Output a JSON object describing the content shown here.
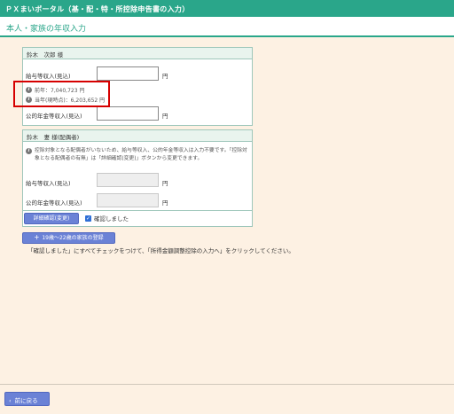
{
  "header": {
    "title": "ＰＸまいポータル（基・配・特・所控除申告書の入力）"
  },
  "page": {
    "title": "本人・家族の年収入力"
  },
  "person1": {
    "name": "鈴木　次郎 様",
    "salary_label": "給与等収入(見込)",
    "salary_value": "",
    "yen": "円",
    "prev_year": "前年：7,040,723 円",
    "current": "当年(現時点)：6,203,652 円",
    "pension_label": "公的年金等収入(見込)",
    "pension_value": "",
    "yen2": "円"
  },
  "person2": {
    "name": "鈴木　妻 様(配偶者)",
    "note": "控除対象となる配偶者がいないため、給与等収入、公的年金等収入は入力不要です。「控除対象となる配偶者の有無」は「詳細確認(変更)」ボタンから変更できます。",
    "salary_label": "給与等収入(見込)",
    "yen": "円",
    "pension_label": "公的年金等収入(見込)",
    "yen2": "円",
    "detail_button": "詳細確認(変更)",
    "confirm_label": "確認しました"
  },
  "add_family_button": "19歳～22歳の家族の登録",
  "instruction": "「確認しました」にすべてチェックをつけて、「所得金額調整控除の入力へ」をクリックしてください。",
  "back_button": "前に戻る",
  "icons": {
    "info": "info-icon",
    "plus": "plus-icon",
    "back": "chevron-left-icon",
    "check": "checkbox-checked-icon"
  },
  "colors": {
    "accent": "#2aa68a",
    "button": "#6b82d6",
    "highlight": "#d60000",
    "background": "#fdf1e3"
  }
}
